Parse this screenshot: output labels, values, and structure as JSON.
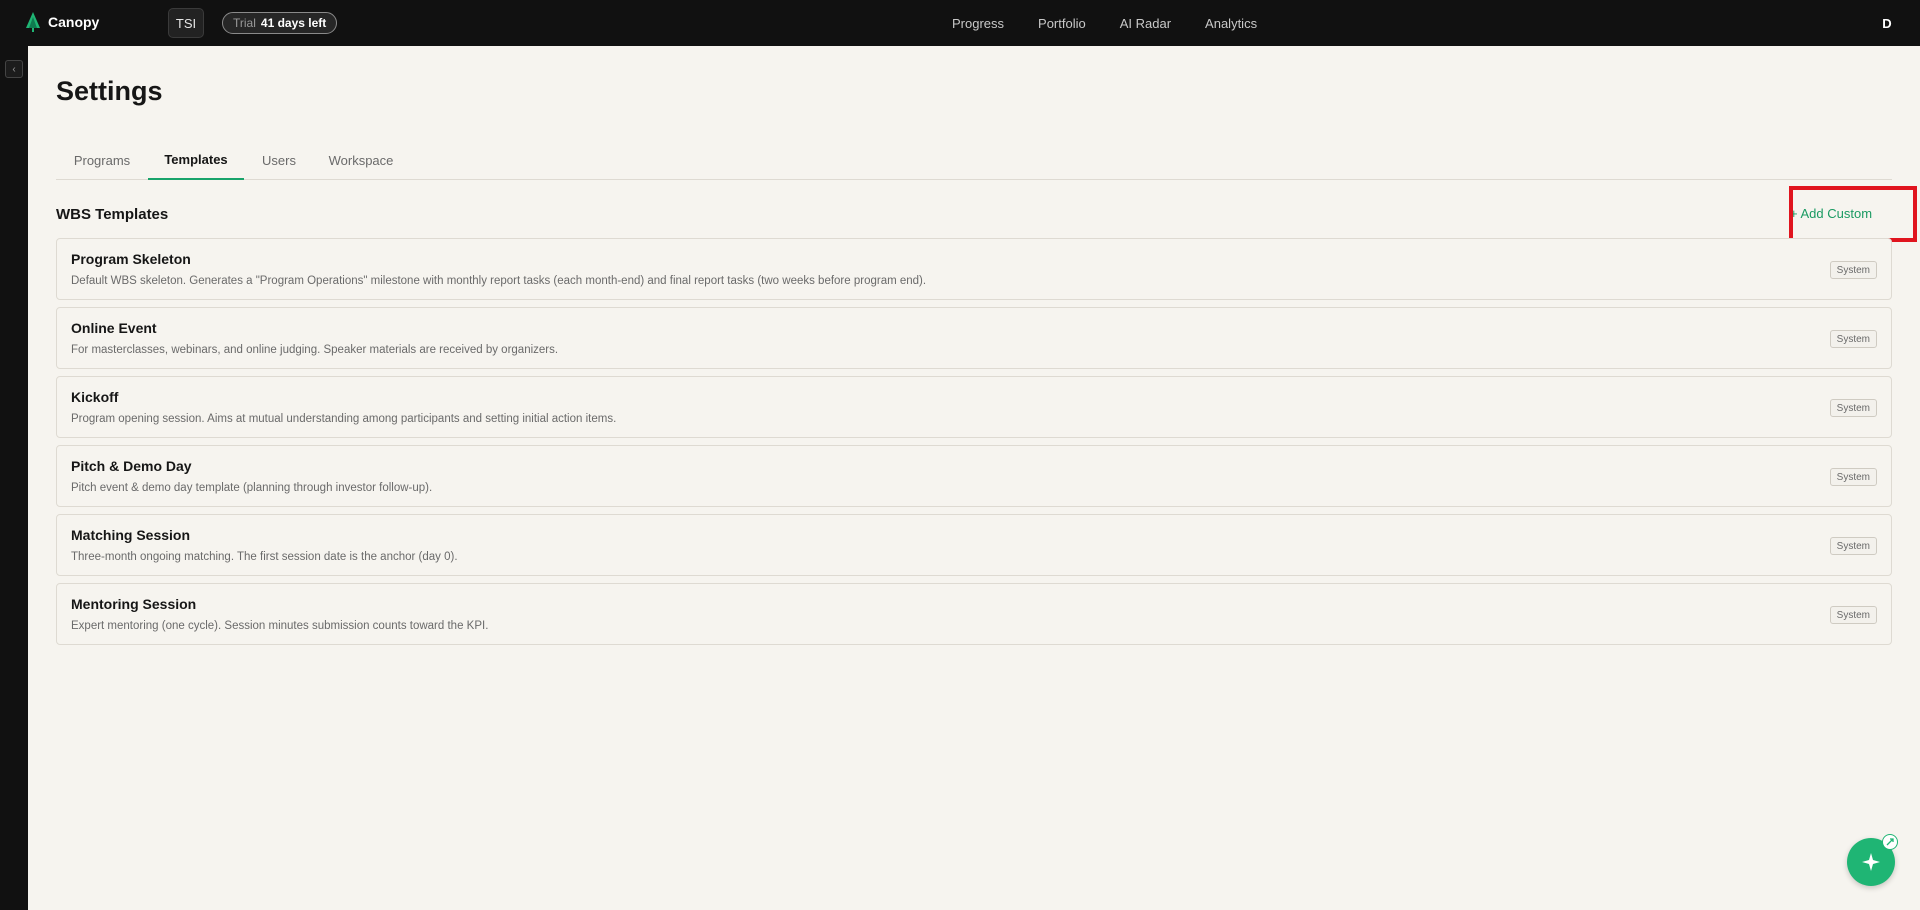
{
  "app": {
    "name": "Canopy",
    "org_badge": "TSI",
    "trial_label": "Trial",
    "trial_days": "41 days left",
    "avatar_initial": "D"
  },
  "nav": {
    "items": [
      {
        "label": "Progress"
      },
      {
        "label": "Portfolio"
      },
      {
        "label": "AI Radar"
      },
      {
        "label": "Analytics"
      }
    ]
  },
  "sidebar": {
    "toggle_glyph": "‹"
  },
  "page": {
    "title": "Settings",
    "tabs": [
      {
        "label": "Programs"
      },
      {
        "label": "Templates",
        "active": true
      },
      {
        "label": "Users"
      },
      {
        "label": "Workspace"
      }
    ]
  },
  "templates": {
    "section_title": "WBS Templates",
    "add_label": "+ Add Custom",
    "items": [
      {
        "name": "Program Skeleton",
        "description": "Default WBS skeleton. Generates a \"Program Operations\" milestone with monthly report tasks (each month-end) and final report tasks (two weeks before program end).",
        "badge": "System"
      },
      {
        "name": "Online Event",
        "description": "For masterclasses, webinars, and online judging. Speaker materials are received by organizers.",
        "badge": "System"
      },
      {
        "name": "Kickoff",
        "description": "Program opening session. Aims at mutual understanding among participants and setting initial action items.",
        "badge": "System"
      },
      {
        "name": "Pitch & Demo Day",
        "description": "Pitch event & demo day template (planning through investor follow-up).",
        "badge": "System"
      },
      {
        "name": "Matching Session",
        "description": "Three-month ongoing matching. The first session date is the anchor (day 0).",
        "badge": "System"
      },
      {
        "name": "Mentoring Session",
        "description": "Expert mentoring (one cycle). Session minutes submission counts toward the KPI.",
        "badge": "System"
      }
    ]
  },
  "colors": {
    "accent": "#18a36a",
    "highlight": "#e0141e",
    "topbar": "#111111",
    "background": "#f6f4ef"
  },
  "icons": {
    "logo": "tree-icon",
    "fab": "sparkle-icon",
    "fab_mini": "expand-icon"
  }
}
